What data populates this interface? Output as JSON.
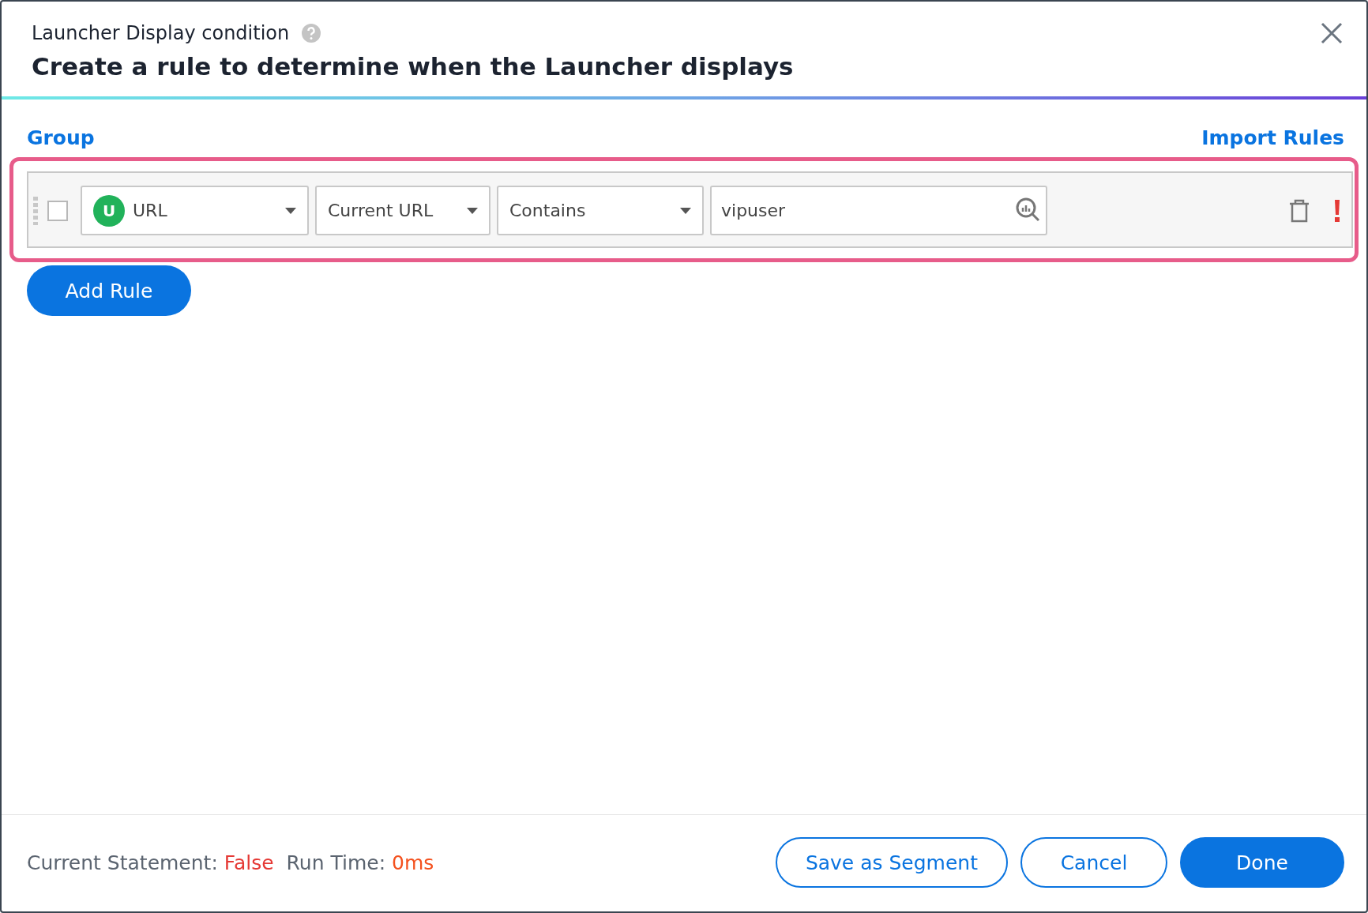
{
  "dialog": {
    "subtitle": "Launcher Display condition",
    "title": "Create a rule to determine when the Launcher displays"
  },
  "group_link": "Group",
  "import_link": "Import Rules",
  "rules": [
    {
      "highlighted": true,
      "checked": false,
      "attribute": {
        "badge": "U",
        "label": "URL"
      },
      "scope": "Current URL",
      "operator": "Contains",
      "value": "vipuser",
      "error": true
    }
  ],
  "add_button": "Add Rule",
  "footer": {
    "statement_label": "Current Statement:",
    "statement_value": "False",
    "runtime_label": "Run Time:",
    "runtime_value": "0ms",
    "buttons": [
      {
        "label": "Save as Segment",
        "primary": false
      },
      {
        "label": "Cancel",
        "primary": false
      },
      {
        "label": "Done",
        "primary": true
      }
    ]
  }
}
